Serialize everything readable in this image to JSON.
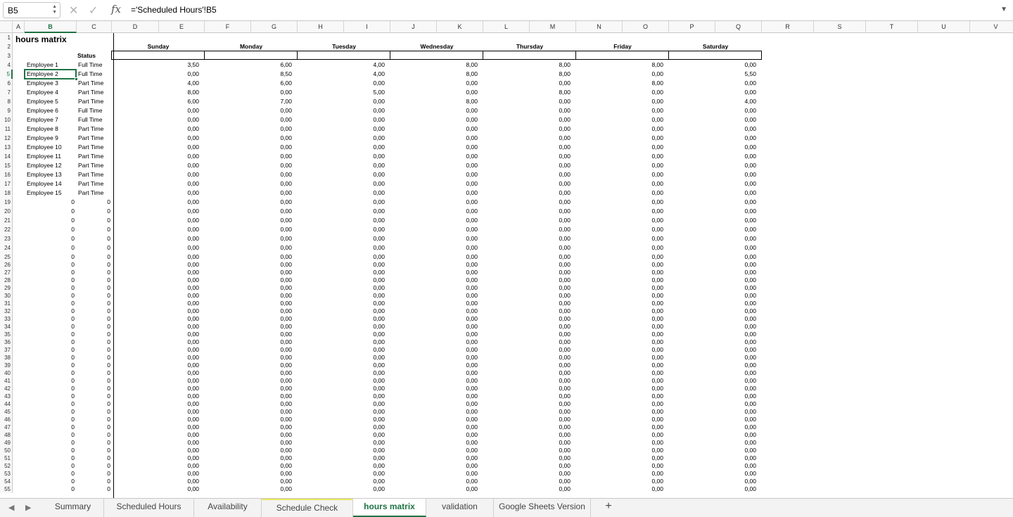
{
  "formula_bar": {
    "name_box": "B5",
    "cancel_icon": "x-icon",
    "enter_icon": "check-icon",
    "fx_label": "fx",
    "formula": "='Scheduled Hours'!B5"
  },
  "columns": [
    "A",
    "B",
    "C",
    "D",
    "E",
    "F",
    "G",
    "H",
    "I",
    "J",
    "K",
    "L",
    "M",
    "N",
    "O",
    "P",
    "Q",
    "R",
    "S",
    "T",
    "U",
    "V"
  ],
  "selected_column": "B",
  "selected_row": 5,
  "sheet": {
    "title": "hours matrix",
    "status_header": "Status",
    "days": [
      "Sunday",
      "Monday",
      "Tuesday",
      "Wednesday",
      "Thursday",
      "Friday",
      "Saturday"
    ],
    "employees": [
      {
        "name": "Employee 1",
        "status": "Full Time",
        "hours": [
          "3,50",
          "6,00",
          "4,00",
          "8,00",
          "8,00",
          "8,00",
          "0,00"
        ]
      },
      {
        "name": "Employee 2",
        "status": "Full Time",
        "hours": [
          "0,00",
          "8,50",
          "4,00",
          "8,00",
          "8,00",
          "0,00",
          "5,50"
        ]
      },
      {
        "name": "Employee 3",
        "status": "Part Time",
        "hours": [
          "4,00",
          "6,00",
          "0,00",
          "0,00",
          "0,00",
          "8,00",
          "0,00"
        ]
      },
      {
        "name": "Employee 4",
        "status": "Part Time",
        "hours": [
          "8,00",
          "0,00",
          "5,00",
          "0,00",
          "8,00",
          "0,00",
          "0,00"
        ]
      },
      {
        "name": "Employee 5",
        "status": "Part Time",
        "hours": [
          "6,00",
          "7,00",
          "0,00",
          "8,00",
          "0,00",
          "0,00",
          "4,00"
        ]
      },
      {
        "name": "Employee 6",
        "status": "Full Time",
        "hours": [
          "0,00",
          "0,00",
          "0,00",
          "0,00",
          "0,00",
          "0,00",
          "0,00"
        ]
      },
      {
        "name": "Employee 7",
        "status": "Full Time",
        "hours": [
          "0,00",
          "0,00",
          "0,00",
          "0,00",
          "0,00",
          "0,00",
          "0,00"
        ]
      },
      {
        "name": "Employee 8",
        "status": "Part Time",
        "hours": [
          "0,00",
          "0,00",
          "0,00",
          "0,00",
          "0,00",
          "0,00",
          "0,00"
        ]
      },
      {
        "name": "Employee 9",
        "status": "Part Time",
        "hours": [
          "0,00",
          "0,00",
          "0,00",
          "0,00",
          "0,00",
          "0,00",
          "0,00"
        ]
      },
      {
        "name": "Employee 10",
        "status": "Part Time",
        "hours": [
          "0,00",
          "0,00",
          "0,00",
          "0,00",
          "0,00",
          "0,00",
          "0,00"
        ]
      },
      {
        "name": "Employee 11",
        "status": "Part Time",
        "hours": [
          "0,00",
          "0,00",
          "0,00",
          "0,00",
          "0,00",
          "0,00",
          "0,00"
        ]
      },
      {
        "name": "Employee 12",
        "status": "Part Time",
        "hours": [
          "0,00",
          "0,00",
          "0,00",
          "0,00",
          "0,00",
          "0,00",
          "0,00"
        ]
      },
      {
        "name": "Employee 13",
        "status": "Part Time",
        "hours": [
          "0,00",
          "0,00",
          "0,00",
          "0,00",
          "0,00",
          "0,00",
          "0,00"
        ]
      },
      {
        "name": "Employee 14",
        "status": "Part Time",
        "hours": [
          "0,00",
          "0,00",
          "0,00",
          "0,00",
          "0,00",
          "0,00",
          "0,00"
        ]
      },
      {
        "name": "Employee 15",
        "status": "Part Time",
        "hours": [
          "0,00",
          "0,00",
          "0,00",
          "0,00",
          "0,00",
          "0,00",
          "0,00"
        ]
      }
    ],
    "empty_row_values": {
      "b": "0",
      "c": "0",
      "hour": "0,00"
    },
    "first_row": 1,
    "last_row": 55
  },
  "tabs": {
    "prev_icon": "triangle-left-icon",
    "next_icon": "triangle-right-icon",
    "items": [
      "Summary",
      "Scheduled Hours",
      "Availability",
      "Schedule Check",
      "hours matrix",
      "validation",
      "Google Sheets Version"
    ],
    "active": "hours matrix",
    "add_label": "+"
  },
  "colors": {
    "accent": "#1f7344",
    "warn_tab": "#e8e85a"
  }
}
